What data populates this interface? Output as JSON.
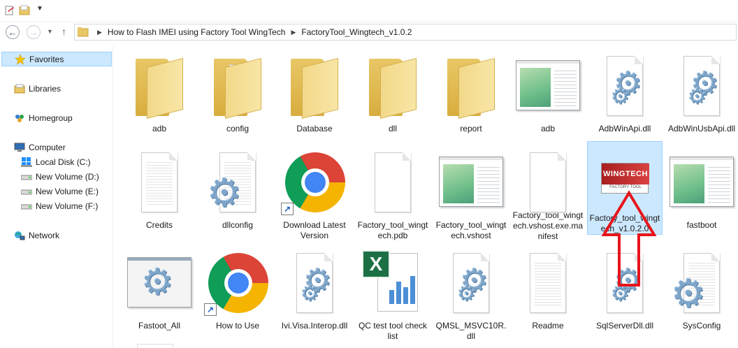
{
  "address_bar": {
    "crumbs": [
      "How to Flash IMEI using Factory Tool WingTech",
      "FactoryTool_Wingtech_v1.0.2"
    ]
  },
  "nav": {
    "favorites": "Favorites",
    "libraries": "Libraries",
    "homegroup": "Homegroup",
    "computer": "Computer",
    "local_disk": "Local Disk (C:)",
    "vol_d": "New Volume (D:)",
    "vol_e": "New Volume (E:)",
    "vol_f": "New Volume (F:)",
    "network": "Network"
  },
  "files": [
    {
      "name": "adb",
      "type": "folder"
    },
    {
      "name": "config",
      "type": "folder"
    },
    {
      "name": "Database",
      "type": "folder"
    },
    {
      "name": "dll",
      "type": "folder"
    },
    {
      "name": "report",
      "type": "folder"
    },
    {
      "name": "adb",
      "type": "application"
    },
    {
      "name": "AdbWinApi.dll",
      "type": "dll"
    },
    {
      "name": "AdbWinUsbApi.dll",
      "type": "dll"
    },
    {
      "name": "Credits",
      "type": "text"
    },
    {
      "name": "dllconfig",
      "type": "config"
    },
    {
      "name": "Download Latest Version",
      "type": "chrome-shortcut"
    },
    {
      "name": "Factory_tool_wingtech.pdb",
      "type": "file"
    },
    {
      "name": "Factory_tool_wingtech.vshost",
      "type": "application"
    },
    {
      "name": "Factory_tool_wingtech.vshost.exe.manifest",
      "type": "file"
    },
    {
      "name": "Factory_tool_wingtech_v1.0.2.0",
      "type": "wingtech-exe",
      "selected": true,
      "logo_text": "WINGTECH",
      "logo_sub": "FACTORY TOOL"
    },
    {
      "name": "fastboot",
      "type": "application"
    },
    {
      "name": "Fastoot_All",
      "type": "batch"
    },
    {
      "name": "How to Use",
      "type": "chrome-shortcut"
    },
    {
      "name": "Ivi.Visa.Interop.dll",
      "type": "dll"
    },
    {
      "name": "QC test tool check list",
      "type": "excel"
    },
    {
      "name": "QMSL_MSVC10R.dll",
      "type": "dll"
    },
    {
      "name": "Readme",
      "type": "text"
    },
    {
      "name": "SqlServerDll.dll",
      "type": "dll"
    },
    {
      "name": "SysConfig",
      "type": "config"
    }
  ],
  "colors": {
    "selection_bg": "#cce8ff",
    "selection_border": "#99d1ff",
    "arrow": "#e8141b"
  }
}
